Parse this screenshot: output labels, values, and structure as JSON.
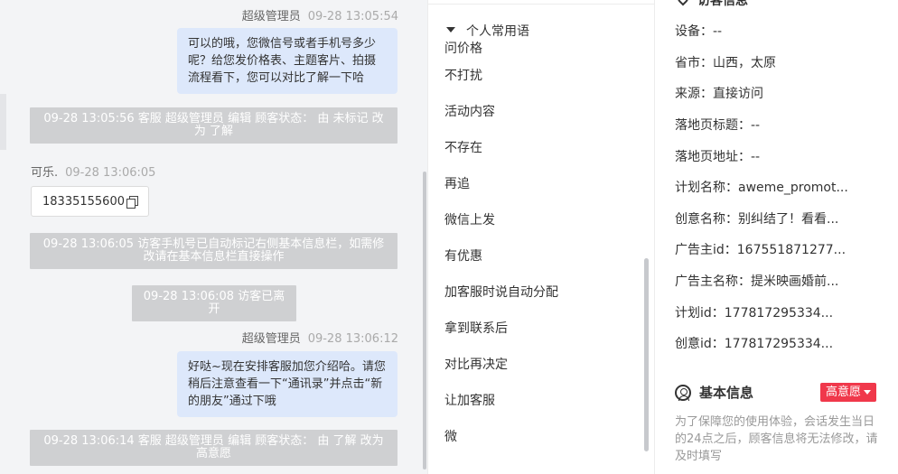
{
  "chat": {
    "messages": [
      {
        "sender": "超级管理员",
        "time": "09-28 13:05:54",
        "text": "可以的哦，您微信号或者手机号多少呢？给您发价格表、主题客片、拍摄流程看下，您可以对比了解一下哈"
      },
      {
        "system": "09-28 13:05:56 客服 超级管理员 编辑 顾客状态： 由 未标记 改为 了解"
      },
      {
        "sender": "可乐.",
        "time": "09-28 13:06:05",
        "text": "18335155600"
      },
      {
        "system": "09-28 13:06:05 访客手机号已自动标记右侧基本信息栏，如需修改请在基本信息栏直接操作"
      },
      {
        "system": "09-28 13:06:08 访客已离开"
      },
      {
        "sender": "超级管理员",
        "time": "09-28 13:06:12",
        "text": "好哒~现在安排客服加您介绍哈。请您稍后注意查看一下“通讯录”并点击“新的朋友”通过下哦"
      },
      {
        "system": "09-28 13:06:14 客服 超级管理员 编辑 顾客状态： 由 了解 改为 高意愿"
      }
    ]
  },
  "phrases": {
    "header": "个人常用语",
    "items": [
      "问价格",
      "不打扰",
      "活动内容",
      "不存在",
      "再追",
      "微信上发",
      "有优惠",
      "加客服时说自动分配",
      "拿到联系后",
      "对比再决定",
      "让加客服",
      "微"
    ]
  },
  "info": {
    "top_title": "访客信息",
    "rows": [
      "设备：--",
      "省市：山西，太原",
      "来源：直接访问",
      "落地页标题：--",
      "落地页地址：--",
      "计划名称：aweme_promot...",
      "创意名称：别纠结了！看看...",
      "广告主id：167551871277...",
      "广告主名称：提米映画婚前...",
      "计划id：177817295334...",
      "创意id：177817295334..."
    ],
    "section_title": "基本信息",
    "badge": "高意愿",
    "notice": "为了保障您的使用体验，会话发生当日的24点之后，顾客信息将无法修改，请及时填写"
  }
}
